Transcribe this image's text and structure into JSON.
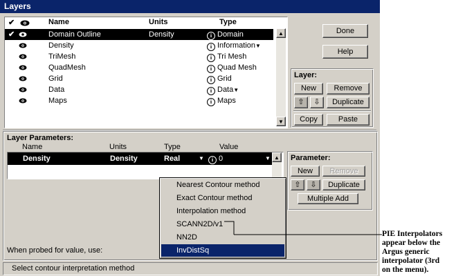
{
  "window": {
    "title": "Layers"
  },
  "layers_table": {
    "headers": {
      "check": "✔",
      "name": "Name",
      "units": "Units",
      "type": "Type"
    },
    "rows": [
      {
        "checked": "✔",
        "name": "Domain Outline",
        "units": "Density",
        "type": "Domain",
        "dropdown": "",
        "selected": true
      },
      {
        "checked": "",
        "name": "Density",
        "units": "",
        "type": "Information",
        "dropdown": "▼",
        "selected": false
      },
      {
        "checked": "",
        "name": "TriMesh",
        "units": "",
        "type": "Tri Mesh",
        "dropdown": "",
        "selected": false
      },
      {
        "checked": "",
        "name": "QuadMesh",
        "units": "",
        "type": "Quad Mesh",
        "dropdown": "",
        "selected": false
      },
      {
        "checked": "",
        "name": "Grid",
        "units": "",
        "type": "Grid",
        "dropdown": "",
        "selected": false
      },
      {
        "checked": "",
        "name": "Data",
        "units": "",
        "type": "Data",
        "dropdown": "▼",
        "selected": false
      },
      {
        "checked": "",
        "name": "Maps",
        "units": "",
        "type": "Maps",
        "dropdown": "",
        "selected": false
      }
    ]
  },
  "buttons": {
    "done": "Done",
    "help": "Help"
  },
  "layer_group": {
    "title": "Layer:",
    "new": "New",
    "remove": "Remove",
    "duplicate": "Duplicate",
    "copy": "Copy",
    "paste": "Paste"
  },
  "layer_params": {
    "title": "Layer Parameters:",
    "headers": {
      "name": "Name",
      "units": "Units",
      "type": "Type",
      "value": "Value"
    },
    "row": {
      "name": "Density",
      "units": "Density",
      "type": "Real",
      "value": "0"
    }
  },
  "param_group": {
    "title": "Parameter:",
    "new": "New",
    "remove": "Remove",
    "duplicate": "Duplicate",
    "multiple_add": "Multiple Add"
  },
  "probe_label": "When probed for value, use:",
  "menu": {
    "items": [
      {
        "label": "Nearest Contour method",
        "highlighted": false
      },
      {
        "label": "Exact Contour method",
        "highlighted": false
      },
      {
        "label": "Interpolation method",
        "highlighted": false
      },
      {
        "label": "SCANN2D/v1",
        "highlighted": false
      },
      {
        "label": "NN2D",
        "highlighted": false
      },
      {
        "label": "InvDistSq",
        "highlighted": true
      }
    ]
  },
  "status": "Select contour interpretation method",
  "annotation": {
    "lines": [
      "PIE Interpolators",
      "appear below the",
      "Argus generic",
      "interpolator (3rd",
      "on the menu)."
    ]
  }
}
